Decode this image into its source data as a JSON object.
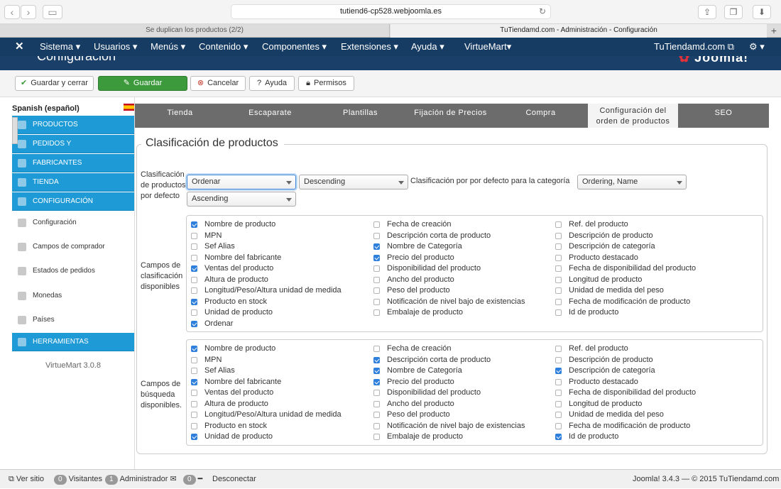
{
  "browser": {
    "url": "tutiend6-cp528.webjoomla.es",
    "tabs": [
      "Se duplican los productos (2/2)",
      "TuTiendamd.com - Administración - Configuración"
    ]
  },
  "topnav": {
    "items": [
      "Sistema ▾",
      "Usuarios ▾",
      "Menús ▾",
      "Contenido ▾",
      "Componentes ▾",
      "Extensiones ▾",
      "Ayuda ▾",
      "VirtueMart▾"
    ],
    "site": "TuTiendamd.com ⧉",
    "gear": "⚙ ▾"
  },
  "header": {
    "title": "Configuración",
    "logo": "Joomla!"
  },
  "toolbar": {
    "save_close": "Guardar y cerrar",
    "save": "Guardar",
    "cancel": "Cancelar",
    "help": "Ayuda",
    "perms": "Permisos"
  },
  "sidebar": {
    "language": "Spanish (español)",
    "sections": [
      "PRODUCTOS",
      "PEDIDOS Y",
      "FABRICANTES",
      "TIENDA",
      "CONFIGURACIÓN"
    ],
    "subitems": [
      "Configuración",
      "Campos de comprador",
      "Estados de pedidos",
      "Monedas",
      "Países"
    ],
    "tools": "HERRAMIENTAS",
    "version": "VirtueMart 3.0.8"
  },
  "tabs": [
    "Tienda",
    "Escaparate",
    "Plantillas",
    "Fijación de Precios",
    "Compra",
    "Configuración del orden de productos",
    "SEO"
  ],
  "form": {
    "legend": "Clasificación de productos",
    "default_label": "Clasificación de productos por defecto",
    "order_by": "Ordenar",
    "direction": "Descending",
    "second_direction": "Ascending",
    "category_label": "Clasificación por por defecto para la categoría",
    "category_value": "Ordering, Name",
    "sort_fields_label": "Campos de clasificación disponibles",
    "search_fields_label": "Campos de búsqueda disponibles."
  },
  "sort_fields": [
    [
      {
        "t": "Nombre de producto",
        "c": true
      },
      {
        "t": "MPN",
        "c": false
      },
      {
        "t": "Sef Alias",
        "c": false
      },
      {
        "t": "Nombre del fabricante",
        "c": false
      },
      {
        "t": "Ventas del producto",
        "c": true
      },
      {
        "t": "Altura de producto",
        "c": false
      },
      {
        "t": "Longitud/Peso/Altura unidad de medida",
        "c": false
      },
      {
        "t": "Producto en stock",
        "c": true
      },
      {
        "t": "Unidad de producto",
        "c": false
      },
      {
        "t": "Ordenar",
        "c": true
      }
    ],
    [
      {
        "t": "Fecha de creación",
        "c": false
      },
      {
        "t": "Descripción corta de producto",
        "c": false
      },
      {
        "t": "Nombre de Categoría",
        "c": true
      },
      {
        "t": "Precio del producto",
        "c": true
      },
      {
        "t": "Disponibilidad del producto",
        "c": false
      },
      {
        "t": "Ancho del producto",
        "c": false
      },
      {
        "t": "Peso del producto",
        "c": false
      },
      {
        "t": "Notificación de nivel bajo de existencias",
        "c": false
      },
      {
        "t": "Embalaje de producto",
        "c": false
      }
    ],
    [
      {
        "t": "Ref. del producto",
        "c": false
      },
      {
        "t": "Descripción de producto",
        "c": false
      },
      {
        "t": "Descripción de categoría",
        "c": false
      },
      {
        "t": "Producto destacado",
        "c": false
      },
      {
        "t": "Fecha de disponibilidad del producto",
        "c": false
      },
      {
        "t": "Longitud de producto",
        "c": false
      },
      {
        "t": "Unidad de medida del peso",
        "c": false
      },
      {
        "t": "Fecha de modificación de producto",
        "c": false
      },
      {
        "t": "Id de producto",
        "c": false
      }
    ]
  ],
  "search_fields": [
    [
      {
        "t": "Nombre de producto",
        "c": true
      },
      {
        "t": "MPN",
        "c": false
      },
      {
        "t": "Sef Alias",
        "c": false
      },
      {
        "t": "Nombre del fabricante",
        "c": true
      },
      {
        "t": "Ventas del producto",
        "c": false
      },
      {
        "t": "Altura de producto",
        "c": false
      },
      {
        "t": "Longitud/Peso/Altura unidad de medida",
        "c": false
      },
      {
        "t": "Producto en stock",
        "c": false
      },
      {
        "t": "Unidad de producto",
        "c": true
      }
    ],
    [
      {
        "t": "Fecha de creación",
        "c": false
      },
      {
        "t": "Descripción corta de producto",
        "c": true
      },
      {
        "t": "Nombre de Categoría",
        "c": true
      },
      {
        "t": "Precio del producto",
        "c": true
      },
      {
        "t": "Disponibilidad del producto",
        "c": false
      },
      {
        "t": "Ancho del producto",
        "c": false
      },
      {
        "t": "Peso del producto",
        "c": false
      },
      {
        "t": "Notificación de nivel bajo de existencias",
        "c": false
      },
      {
        "t": "Embalaje de producto",
        "c": false
      }
    ],
    [
      {
        "t": "Ref. del producto",
        "c": false
      },
      {
        "t": "Descripción de producto",
        "c": false
      },
      {
        "t": "Descripción de categoría",
        "c": true
      },
      {
        "t": "Producto destacado",
        "c": false
      },
      {
        "t": "Fecha de disponibilidad del producto",
        "c": false
      },
      {
        "t": "Longitud de producto",
        "c": false
      },
      {
        "t": "Unidad de medida del peso",
        "c": false
      },
      {
        "t": "Fecha de modificación de producto",
        "c": false
      },
      {
        "t": "Id de producto",
        "c": true
      }
    ]
  ],
  "footer": {
    "view_site": "Ver sitio",
    "visitors_count": "0",
    "visitors": "Visitantes",
    "admin_count": "1",
    "admin": "Administrador",
    "msg_count": "0",
    "logout": "Desconectar",
    "copyright": "Joomla! 3.4.3  —  © 2015 TuTiendamd.com"
  }
}
